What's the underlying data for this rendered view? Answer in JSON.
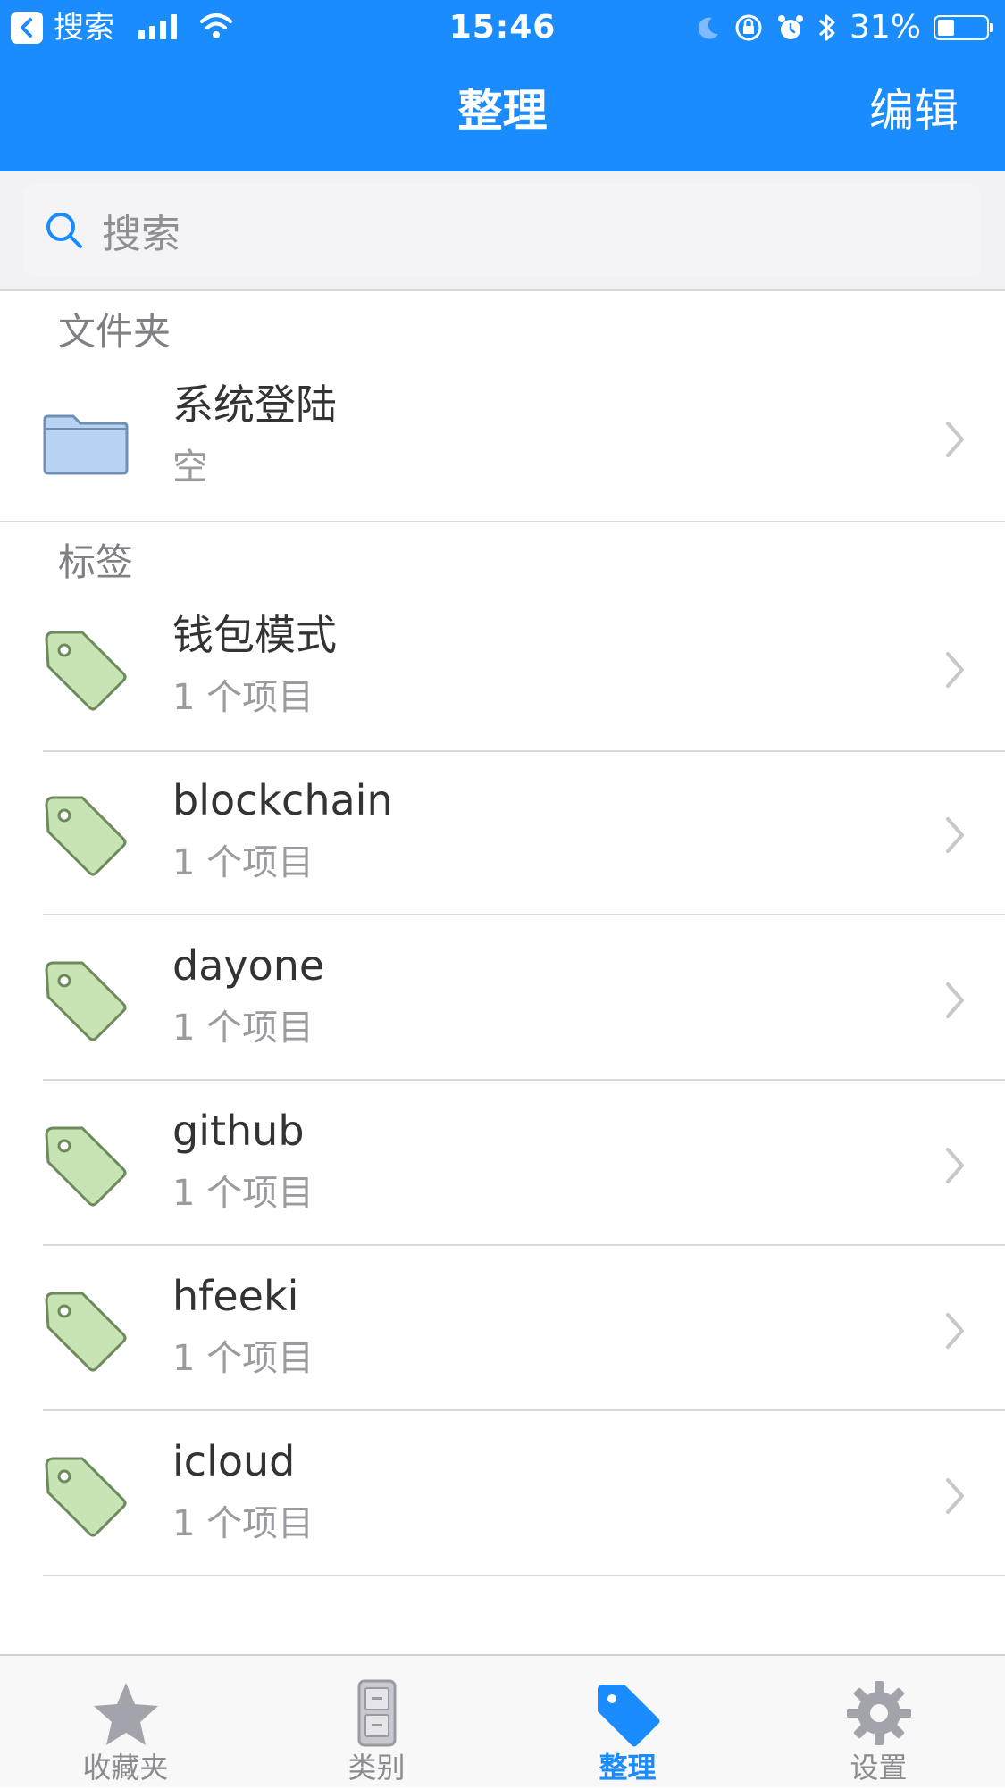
{
  "status_bar": {
    "back_app": "搜索",
    "time": "15:46",
    "battery": "31%"
  },
  "nav": {
    "title": "整理",
    "edit": "编辑"
  },
  "search": {
    "placeholder": "搜索"
  },
  "folders": {
    "header": "文件夹",
    "items": [
      {
        "name": "系统登陆",
        "subtitle": "空",
        "icon": "folder-icon"
      }
    ]
  },
  "tags": {
    "header": "标签",
    "items": [
      {
        "name": "钱包模式",
        "subtitle": "1 个项目",
        "icon": "tag-icon"
      },
      {
        "name": "blockchain",
        "subtitle": "1 个项目",
        "icon": "tag-icon"
      },
      {
        "name": "dayone",
        "subtitle": "1 个项目",
        "icon": "tag-icon"
      },
      {
        "name": "github",
        "subtitle": "1 个项目",
        "icon": "tag-icon"
      },
      {
        "name": "hfeeki",
        "subtitle": "1 个项目",
        "icon": "tag-icon"
      },
      {
        "name": "icloud",
        "subtitle": "1 个项目",
        "icon": "tag-icon"
      }
    ]
  },
  "tab_bar": {
    "items": [
      {
        "label": "收藏夹",
        "icon": "star-icon",
        "active": false
      },
      {
        "label": "类别",
        "icon": "cabinet-icon",
        "active": false
      },
      {
        "label": "整理",
        "icon": "tag-icon",
        "active": true
      },
      {
        "label": "设置",
        "icon": "gear-icon",
        "active": false
      }
    ]
  },
  "colors": {
    "accent": "#1a8cfe",
    "tag_fill": "#c8e3b4",
    "folder_fill": "#b9d3f2"
  }
}
